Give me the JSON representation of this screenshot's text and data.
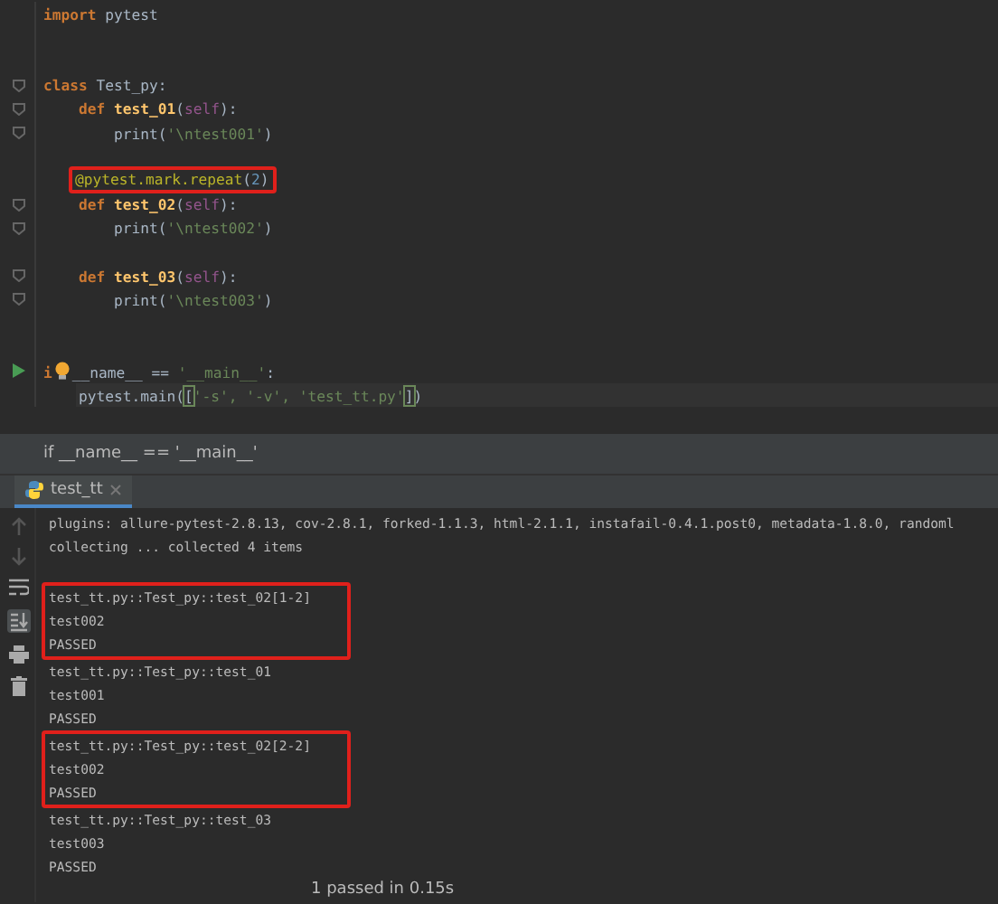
{
  "editor": {
    "lines": [
      {
        "kind": "code",
        "tokens": [
          {
            "kind": "keyword",
            "text": "import"
          },
          {
            "kind": "plain",
            "text": " pytest"
          }
        ]
      },
      {
        "kind": "blank"
      },
      {
        "kind": "blank"
      },
      {
        "kind": "code",
        "fold": true,
        "tokens": [
          {
            "kind": "keyword",
            "text": "class"
          },
          {
            "kind": "plain",
            "text": " Test_py:"
          }
        ],
        "children": [
          {
            "kind": "code",
            "fold": true,
            "tokens": [
              {
                "kind": "keyword",
                "text": "def"
              },
              {
                "kind": "function",
                "text": " test_01"
              },
              {
                "kind": "plain",
                "text": "("
              },
              {
                "kind": "self",
                "text": "self"
              },
              {
                "kind": "plain",
                "text": "):"
              }
            ],
            "children": [
              {
                "kind": "code",
                "fold": true,
                "tokens": [
                  {
                    "kind": "plain",
                    "text": "print("
                  },
                  {
                    "kind": "string",
                    "text": "'\\ntest001'"
                  },
                  {
                    "kind": "plain",
                    "text": ")"
                  }
                ]
              }
            ]
          },
          {
            "kind": "blank"
          },
          {
            "kind": "code",
            "boxed": true,
            "tokens": [
              {
                "kind": "decorator",
                "text": "@pytest.mark.repeat"
              },
              {
                "kind": "plain",
                "text": "("
              },
              {
                "kind": "number",
                "text": "2"
              },
              {
                "kind": "plain",
                "text": ")"
              }
            ]
          },
          {
            "kind": "code",
            "fold": true,
            "tokens": [
              {
                "kind": "keyword",
                "text": "def"
              },
              {
                "kind": "function",
                "text": " test_02"
              },
              {
                "kind": "plain",
                "text": "("
              },
              {
                "kind": "self",
                "text": "self"
              },
              {
                "kind": "plain",
                "text": "):"
              }
            ],
            "children": [
              {
                "kind": "code",
                "fold": true,
                "tokens": [
                  {
                    "kind": "plain",
                    "text": "print("
                  },
                  {
                    "kind": "string",
                    "text": "'\\ntest002'"
                  },
                  {
                    "kind": "plain",
                    "text": ")"
                  }
                ]
              }
            ]
          },
          {
            "kind": "blank"
          },
          {
            "kind": "code",
            "fold": true,
            "tokens": [
              {
                "kind": "keyword",
                "text": "def"
              },
              {
                "kind": "function",
                "text": " test_03"
              },
              {
                "kind": "plain",
                "text": "("
              },
              {
                "kind": "self",
                "text": "self"
              },
              {
                "kind": "plain",
                "text": "):"
              }
            ],
            "children": [
              {
                "kind": "code",
                "fold": true,
                "tokens": [
                  {
                    "kind": "plain",
                    "text": "print("
                  },
                  {
                    "kind": "string",
                    "text": "'\\ntest003'"
                  },
                  {
                    "kind": "plain",
                    "text": ")"
                  }
                ]
              }
            ]
          }
        ]
      },
      {
        "kind": "blank"
      },
      {
        "kind": "blank"
      },
      {
        "kind": "code",
        "runnable": true,
        "tokens": [
          {
            "kind": "keyword",
            "text": "i"
          },
          {
            "kind": "bulb"
          },
          {
            "kind": "plain",
            "text": "__name__ == "
          },
          {
            "kind": "string",
            "text": "'__main__'"
          },
          {
            "kind": "plain",
            "text": ":"
          }
        ],
        "children": [
          {
            "kind": "code",
            "current": true,
            "tokens": [
              {
                "kind": "plain",
                "text": "pytest.main("
              },
              {
                "kind": "bracket",
                "text": "["
              },
              {
                "kind": "string",
                "text": "'-s', '-v', 'test_tt.py'"
              },
              {
                "kind": "bracket",
                "text": "]"
              },
              {
                "kind": "plain",
                "text": ")"
              }
            ]
          }
        ]
      }
    ]
  },
  "breadcrumb": "if __name__ == '__main__'",
  "run_tab": {
    "label": "test_tt",
    "selected": true
  },
  "console": {
    "groups": [
      {
        "boxed": false,
        "lines": [
          "plugins: allure-pytest-2.8.13, cov-2.8.1, forked-1.1.3, html-2.1.1, instafail-0.4.1.post0, metadata-1.8.0, randoml",
          "collecting ... collected 4 items"
        ]
      },
      {
        "boxed": true,
        "lines": [
          "test_tt.py::Test_py::test_02[1-2]",
          "test002",
          "PASSED"
        ]
      },
      {
        "boxed": false,
        "lines": [
          "test_tt.py::Test_py::test_01",
          "test001",
          "PASSED"
        ]
      },
      {
        "boxed": true,
        "lines": [
          "test_tt.py::Test_py::test_02[2-2]",
          "test002",
          "PASSED"
        ]
      },
      {
        "boxed": false,
        "lines": [
          "test_tt.py::Test_py::test_03",
          "test003",
          "PASSED"
        ]
      }
    ],
    "summary": "1 passed in 0.15s"
  }
}
